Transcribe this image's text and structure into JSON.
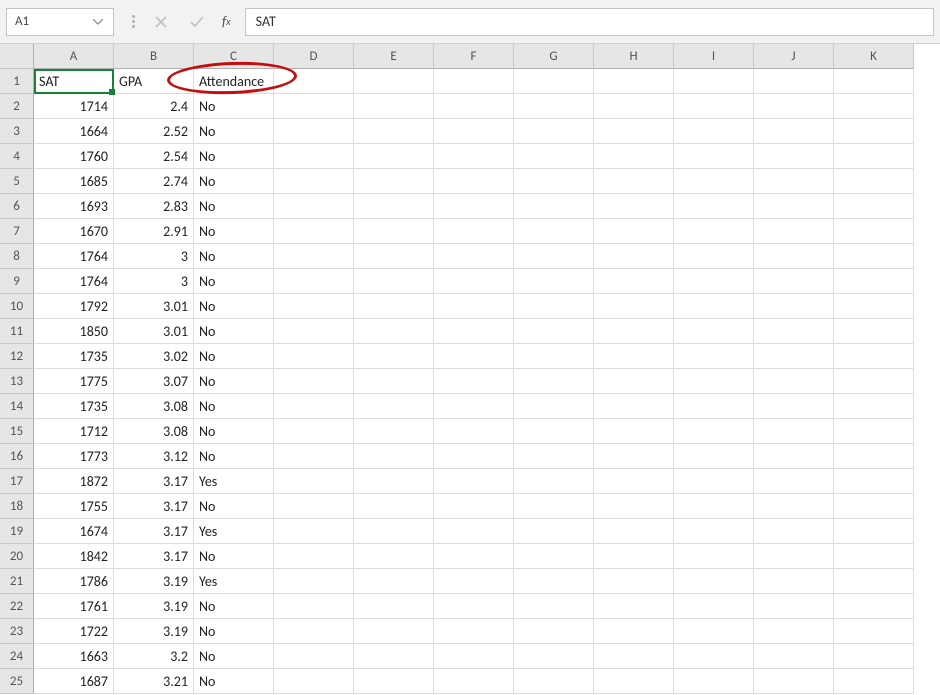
{
  "name_box": "A1",
  "formula_value": "SAT",
  "columns": [
    "A",
    "B",
    "C",
    "D",
    "E",
    "F",
    "G",
    "H",
    "I",
    "J",
    "K"
  ],
  "headers": {
    "A": "SAT",
    "B": "GPA",
    "C": "Attendance"
  },
  "rows": [
    {
      "n": 1,
      "A": "SAT",
      "B": "GPA",
      "C": "Attendance"
    },
    {
      "n": 2,
      "A": 1714,
      "B": 2.4,
      "C": "No"
    },
    {
      "n": 3,
      "A": 1664,
      "B": 2.52,
      "C": "No"
    },
    {
      "n": 4,
      "A": 1760,
      "B": 2.54,
      "C": "No"
    },
    {
      "n": 5,
      "A": 1685,
      "B": 2.74,
      "C": "No"
    },
    {
      "n": 6,
      "A": 1693,
      "B": 2.83,
      "C": "No"
    },
    {
      "n": 7,
      "A": 1670,
      "B": 2.91,
      "C": "No"
    },
    {
      "n": 8,
      "A": 1764,
      "B": 3,
      "C": "No"
    },
    {
      "n": 9,
      "A": 1764,
      "B": 3,
      "C": "No"
    },
    {
      "n": 10,
      "A": 1792,
      "B": 3.01,
      "C": "No"
    },
    {
      "n": 11,
      "A": 1850,
      "B": 3.01,
      "C": "No"
    },
    {
      "n": 12,
      "A": 1735,
      "B": 3.02,
      "C": "No"
    },
    {
      "n": 13,
      "A": 1775,
      "B": 3.07,
      "C": "No"
    },
    {
      "n": 14,
      "A": 1735,
      "B": 3.08,
      "C": "No"
    },
    {
      "n": 15,
      "A": 1712,
      "B": 3.08,
      "C": "No"
    },
    {
      "n": 16,
      "A": 1773,
      "B": 3.12,
      "C": "No"
    },
    {
      "n": 17,
      "A": 1872,
      "B": 3.17,
      "C": "Yes"
    },
    {
      "n": 18,
      "A": 1755,
      "B": 3.17,
      "C": "No"
    },
    {
      "n": 19,
      "A": 1674,
      "B": 3.17,
      "C": "Yes"
    },
    {
      "n": 20,
      "A": 1842,
      "B": 3.17,
      "C": "No"
    },
    {
      "n": 21,
      "A": 1786,
      "B": 3.19,
      "C": "Yes"
    },
    {
      "n": 22,
      "A": 1761,
      "B": 3.19,
      "C": "No"
    },
    {
      "n": 23,
      "A": 1722,
      "B": 3.19,
      "C": "No"
    },
    {
      "n": 24,
      "A": 1663,
      "B": 3.2,
      "C": "No"
    },
    {
      "n": 25,
      "A": 1687,
      "B": 3.21,
      "C": "No"
    }
  ]
}
